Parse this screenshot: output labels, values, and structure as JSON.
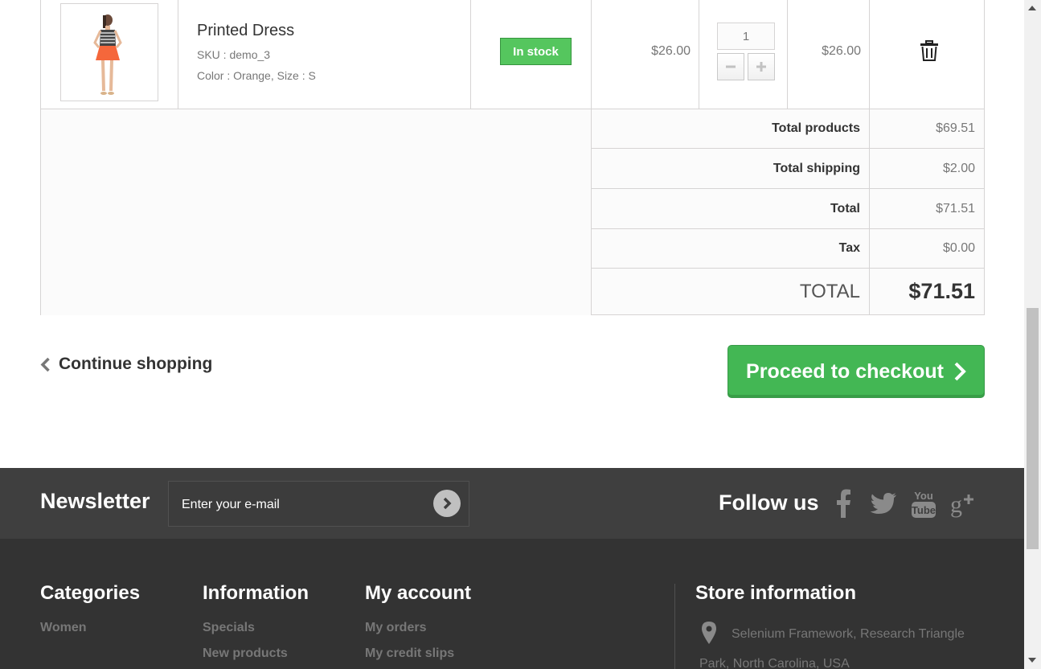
{
  "cart_item": {
    "name": "Printed Dress",
    "sku": "SKU : demo_3",
    "attributes": "Color : Orange, Size : S",
    "availability": "In stock",
    "unit_price": "$26.00",
    "quantity": "1",
    "total": "$26.00"
  },
  "summary": {
    "total_products_label": "Total products",
    "total_products_value": "$69.51",
    "total_shipping_label": "Total shipping",
    "total_shipping_value": "$2.00",
    "total_label": "Total",
    "total_value": "$71.51",
    "tax_label": "Tax",
    "tax_value": "$0.00",
    "grand_label": "TOTAL",
    "grand_value": "$71.51"
  },
  "nav": {
    "continue_label": "Continue shopping",
    "checkout_label": "Proceed to checkout"
  },
  "newsletter": {
    "title": "Newsletter",
    "placeholder": "Enter your e-mail"
  },
  "follow": {
    "title": "Follow us",
    "networks": [
      "facebook-icon",
      "twitter-icon",
      "youtube-icon",
      "google-plus-icon"
    ]
  },
  "footer": {
    "categories": {
      "title": "Categories",
      "links": [
        "Women"
      ]
    },
    "information": {
      "title": "Information",
      "links": [
        "Specials",
        "New products"
      ]
    },
    "account": {
      "title": "My account",
      "links": [
        "My orders",
        "My credit slips"
      ]
    },
    "store": {
      "title": "Store information",
      "address_line1": "Selenium Framework, Research Triangle",
      "address_line2": "Park, North Carolina, USA"
    }
  },
  "colors": {
    "in_stock": "#55c65e",
    "checkout": "#43b754",
    "footer_dark": "#333333",
    "newsletter_bar": "#3f3f3f"
  }
}
